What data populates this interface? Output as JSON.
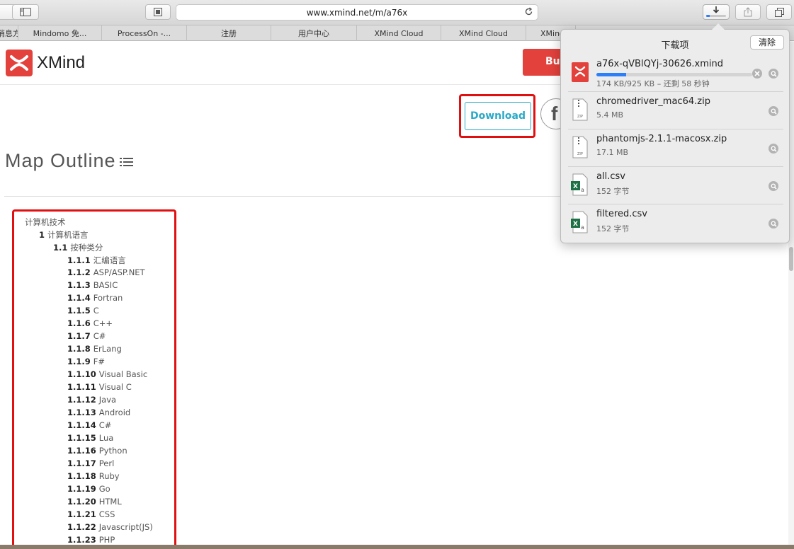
{
  "browser": {
    "url": "www.xmind.net/m/a76x",
    "bookmarks": [
      "消息方",
      "Mindomo 免...",
      "ProcessOn -...",
      "注册",
      "用户中心",
      "XMind Cloud",
      "XMind Cloud",
      "XMind"
    ],
    "download_progress": 0.19,
    "accent_color": "#2d7ff9"
  },
  "site": {
    "logo_text": "XMind",
    "buy_label": "Buy",
    "download_label": "Download",
    "social_letter": "f",
    "outline_title": "Map Outline",
    "brand_color": "#e2413c",
    "highlight_color": "#e01010"
  },
  "outline": {
    "root": "计算机技术",
    "level1": {
      "num": "1",
      "label": "计算机语言"
    },
    "level2": {
      "num": "1.1",
      "label": "按种类分"
    },
    "items": [
      {
        "num": "1.1.1",
        "label": "汇编语言"
      },
      {
        "num": "1.1.2",
        "label": "ASP/ASP.NET"
      },
      {
        "num": "1.1.3",
        "label": "BASIC"
      },
      {
        "num": "1.1.4",
        "label": "Fortran"
      },
      {
        "num": "1.1.5",
        "label": "C"
      },
      {
        "num": "1.1.6",
        "label": "C++"
      },
      {
        "num": "1.1.7",
        "label": "C#"
      },
      {
        "num": "1.1.8",
        "label": "ErLang"
      },
      {
        "num": "1.1.9",
        "label": "F#"
      },
      {
        "num": "1.1.10",
        "label": "Visual Basic"
      },
      {
        "num": "1.1.11",
        "label": "Visual C"
      },
      {
        "num": "1.1.12",
        "label": "Java"
      },
      {
        "num": "1.1.13",
        "label": "Android"
      },
      {
        "num": "1.1.14",
        "label": "C#"
      },
      {
        "num": "1.1.15",
        "label": "Lua"
      },
      {
        "num": "1.1.16",
        "label": "Python"
      },
      {
        "num": "1.1.17",
        "label": "Perl"
      },
      {
        "num": "1.1.18",
        "label": "Ruby"
      },
      {
        "num": "1.1.19",
        "label": "Go"
      },
      {
        "num": "1.1.20",
        "label": "HTML"
      },
      {
        "num": "1.1.21",
        "label": "CSS"
      },
      {
        "num": "1.1.22",
        "label": "Javascript(JS)"
      },
      {
        "num": "1.1.23",
        "label": "PHP"
      }
    ]
  },
  "downloads": {
    "title": "下载项",
    "clear_label": "清除",
    "items": [
      {
        "name": "a76x-qVBlQYj-30626.xmind",
        "meta": "174 KB/925 KB – 还剩 58 秒钟",
        "icon": "xmind-file-icon",
        "progress": 0.19
      },
      {
        "name": "chromedriver_mac64.zip",
        "meta": "5.4 MB",
        "icon": "zip-file-icon"
      },
      {
        "name": "phantomjs-2.1.1-macosx.zip",
        "meta": "17.1 MB",
        "icon": "zip-file-icon"
      },
      {
        "name": "all.csv",
        "meta": "152 字节",
        "icon": "excel-file-icon"
      },
      {
        "name": "filtered.csv",
        "meta": "152 字节",
        "icon": "excel-file-icon"
      }
    ]
  }
}
